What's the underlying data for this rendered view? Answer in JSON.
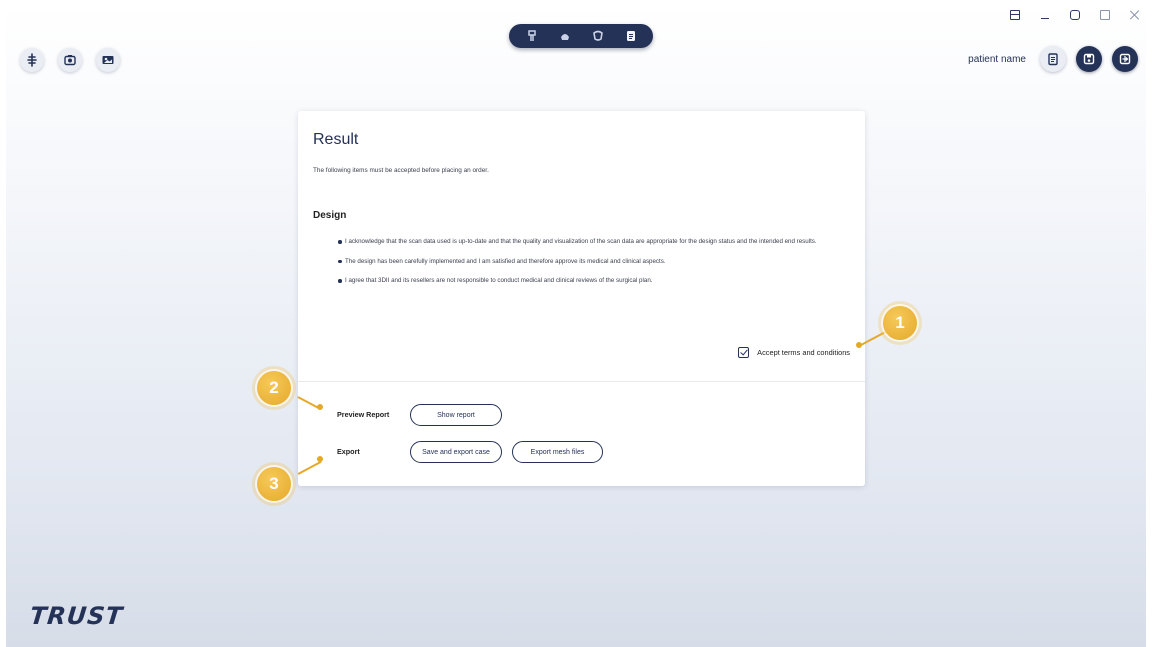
{
  "window_controls": {
    "layout_icon": "layout-icon",
    "minimize_icon": "minimize-icon",
    "maximize_icon": "maximize-icon",
    "popout_icon": "popout-icon",
    "close_icon": "close-icon"
  },
  "left_tools": [
    "implant-tool-icon",
    "camera-icon",
    "image-icon"
  ],
  "workflow_steps": [
    {
      "icon": "implant-step-icon",
      "active": false
    },
    {
      "icon": "guide-step-icon",
      "active": false
    },
    {
      "icon": "tooth-step-icon",
      "active": false
    },
    {
      "icon": "result-step-icon",
      "active": true
    }
  ],
  "header": {
    "patient_name": "patient name",
    "clipboard_icon": "clipboard-icon",
    "save_icon": "save-icon",
    "exit_icon": "exit-icon"
  },
  "result": {
    "title": "Result",
    "intro": "The following items must be accepted before placing an order.",
    "design_title": "Design",
    "bullets": [
      "I acknowledge that the scan data used is up-to-date and that the quality and visualization of the scan data are appropriate for the design status and the intended end results.",
      "The design has been carefully implemented and I am satisfied and therefore approve its medical and clinical aspects.",
      "I agree that 3DII and its resellers are not responsible to conduct medical and clinical reviews of the surgical plan."
    ],
    "accept_label": "Accept terms and conditions",
    "accept_checked": true,
    "preview_label": "Preview Report",
    "show_report_button": "Show report",
    "export_label": "Export",
    "save_export_button": "Save and export case",
    "export_mesh_button": "Export mesh files"
  },
  "callouts": [
    "1",
    "2",
    "3"
  ],
  "brand": {
    "logo_text": "TRUST",
    "accent_color": "#253257",
    "callout_color": "#e5a92a"
  }
}
